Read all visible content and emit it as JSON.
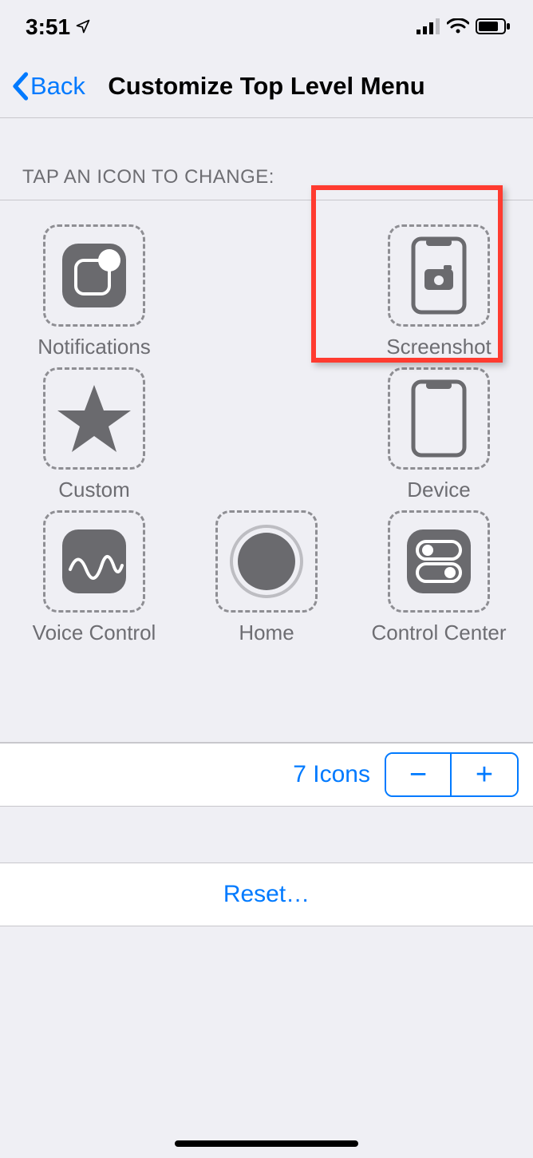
{
  "status_bar": {
    "time": "3:51"
  },
  "nav": {
    "back": "Back",
    "title": "Customize Top Level Menu"
  },
  "section_header": "TAP AN ICON TO CHANGE:",
  "icons": {
    "notifications": "Notifications",
    "screenshot": "Screenshot",
    "custom": "Custom",
    "device": "Device",
    "voice_control": "Voice Control",
    "home": "Home",
    "control_center": "Control Center"
  },
  "counter": {
    "label": "7 Icons",
    "minus": "−",
    "plus": "+"
  },
  "reset": "Reset…"
}
